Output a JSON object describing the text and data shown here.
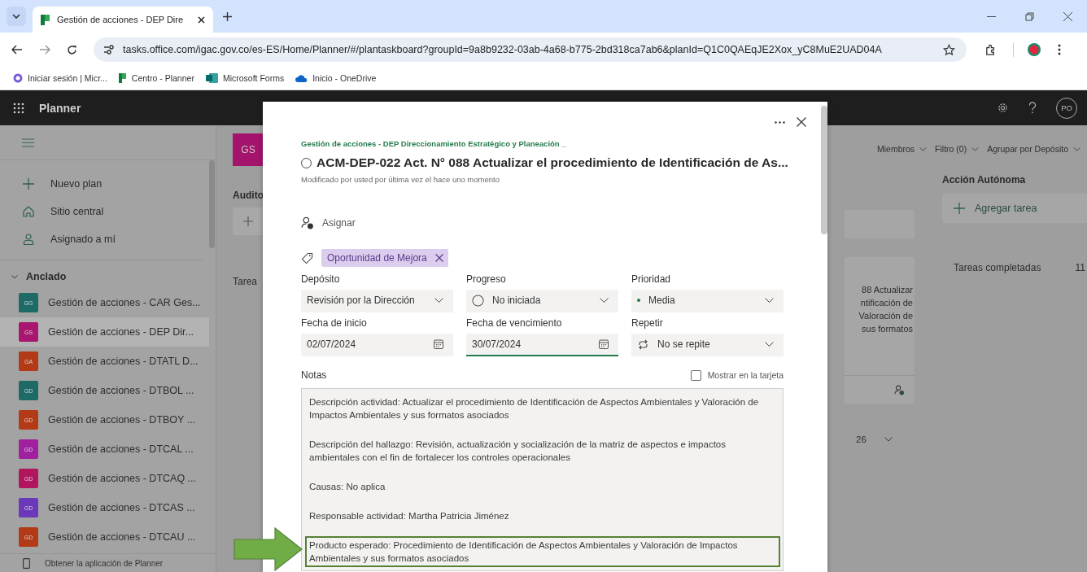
{
  "browser": {
    "tab_title": "Gestión de acciones - DEP Dire",
    "url": "tasks.office.com/igac.gov.co/es-ES/Home/Planner/#/plantaskboard?groupId=9a8b9232-03ab-4a68-b775-2bd318ca7ab6&planId=Q1C0QAEqJE2Xox_yC8MuE2UAD04A",
    "bookmarks": [
      {
        "label": "Iniciar sesión | Micr...",
        "kind": "office"
      },
      {
        "label": "Centro - Planner",
        "kind": "planner"
      },
      {
        "label": "Microsoft Forms",
        "kind": "forms"
      },
      {
        "label": "Inicio - OneDrive",
        "kind": "onedrive"
      }
    ]
  },
  "app_bar": {
    "title": "Planner",
    "avatar": "PO"
  },
  "sidebar": {
    "nav": [
      {
        "label": "Nuevo plan",
        "kind": "plus"
      },
      {
        "label": "Sitio central",
        "kind": "home"
      },
      {
        "label": "Asignado a mí",
        "kind": "person"
      }
    ],
    "section": "Anclado",
    "expanded": true,
    "plans": [
      {
        "initials": "GG",
        "label": "Gestión de acciones - CAR Ges...",
        "color": "#1d6a66",
        "selected": false
      },
      {
        "initials": "GS",
        "label": "Gestión de acciones - DEP Dir...",
        "color": "#a8166f",
        "selected": true
      },
      {
        "initials": "GA",
        "label": "Gestión de acciones - DTATL D...",
        "color": "#b23a17",
        "selected": false
      },
      {
        "initials": "GD",
        "label": "Gestión de acciones - DTBOL ...",
        "color": "#1d6a66",
        "selected": false
      },
      {
        "initials": "GD",
        "label": "Gestión de acciones - DTBOY ...",
        "color": "#b23a17",
        "selected": false
      },
      {
        "initials": "GD",
        "label": "Gestión de acciones - DTCAL ...",
        "color": "#a020a0",
        "selected": false
      },
      {
        "initials": "GD",
        "label": "Gestión de acciones - DTCAQ ...",
        "color": "#b0155e",
        "selected": false
      },
      {
        "initials": "GD",
        "label": "Gestión de acciones - DTCAS ...",
        "color": "#6a38b8",
        "selected": false
      },
      {
        "initials": "GD",
        "label": "Gestión de acciones - DTCAU ...",
        "color": "#b23a17",
        "selected": false
      }
    ],
    "footer": "Obtener la aplicación de Planner"
  },
  "board": {
    "plan_tile": "GS",
    "left_bucket": "Audito",
    "left_hint": "Tarea",
    "toolbar": [
      "Miembros",
      "Filtro (0)",
      "Agrupar por Depósito"
    ],
    "card_lines": [
      "88 Actualizar",
      "ntificación de",
      "Valoración de",
      "sus formatos"
    ],
    "date_group": "26",
    "bucket": {
      "name": "Acción Autónoma",
      "add_task": "Agregar tarea",
      "completed_label": "Tareas completadas",
      "completed_count": "11"
    }
  },
  "task": {
    "plan": "Gestión de acciones - DEP Direccionamiento Estratégico y Planeación _",
    "title": "ACM-DEP-022 Act. N° 088 Actualizar el procedimiento de Identificación de As...",
    "completed": false,
    "modified": "Modificado por usted por última vez el hace uno momento",
    "assign": "Asignar",
    "labels": [
      "Oportunidad de Mejora"
    ],
    "fields": [
      {
        "label": "Depósito",
        "value": "Revisión por la Dirección",
        "kind": "select",
        "focused": false
      },
      {
        "label": "Progreso",
        "value": "No iniciada",
        "kind": "progress",
        "focused": false
      },
      {
        "label": "Prioridad",
        "value": "Media",
        "kind": "priority",
        "focused": false
      },
      {
        "label": "Fecha de inicio",
        "value": "02/07/2024",
        "kind": "date",
        "focused": false
      },
      {
        "label": "Fecha de vencimiento",
        "value": "30/07/2024",
        "kind": "date",
        "focused": true
      },
      {
        "label": "Repetir",
        "value": "No se repite",
        "kind": "repeat",
        "focused": false
      }
    ],
    "notes_label": "Notas",
    "show_on_card": {
      "label": "Mostrar en la tarjeta",
      "checked": false
    },
    "notes": [
      {
        "text": "Descripción actividad: Actualizar el procedimiento de Identificación de Aspectos Ambientales y Valoración de Impactos Ambientales y sus formatos asociados",
        "highlighted": false
      },
      {
        "text": "Descripción del hallazgo: Revisión, actualización y socialización de la matriz de aspectos e impactos ambientales con el fin de fortalecer los controles operacionales",
        "highlighted": false
      },
      {
        "text": "Causas: No aplica",
        "highlighted": false
      },
      {
        "text": "Responsable actividad: Martha Patricia Jiménez",
        "highlighted": false
      },
      {
        "text": "Producto esperado: Procedimiento de Identificación de Aspectos Ambientales y Valoración de Impactos Ambientales y sus formatos asociados",
        "highlighted": true
      }
    ]
  }
}
